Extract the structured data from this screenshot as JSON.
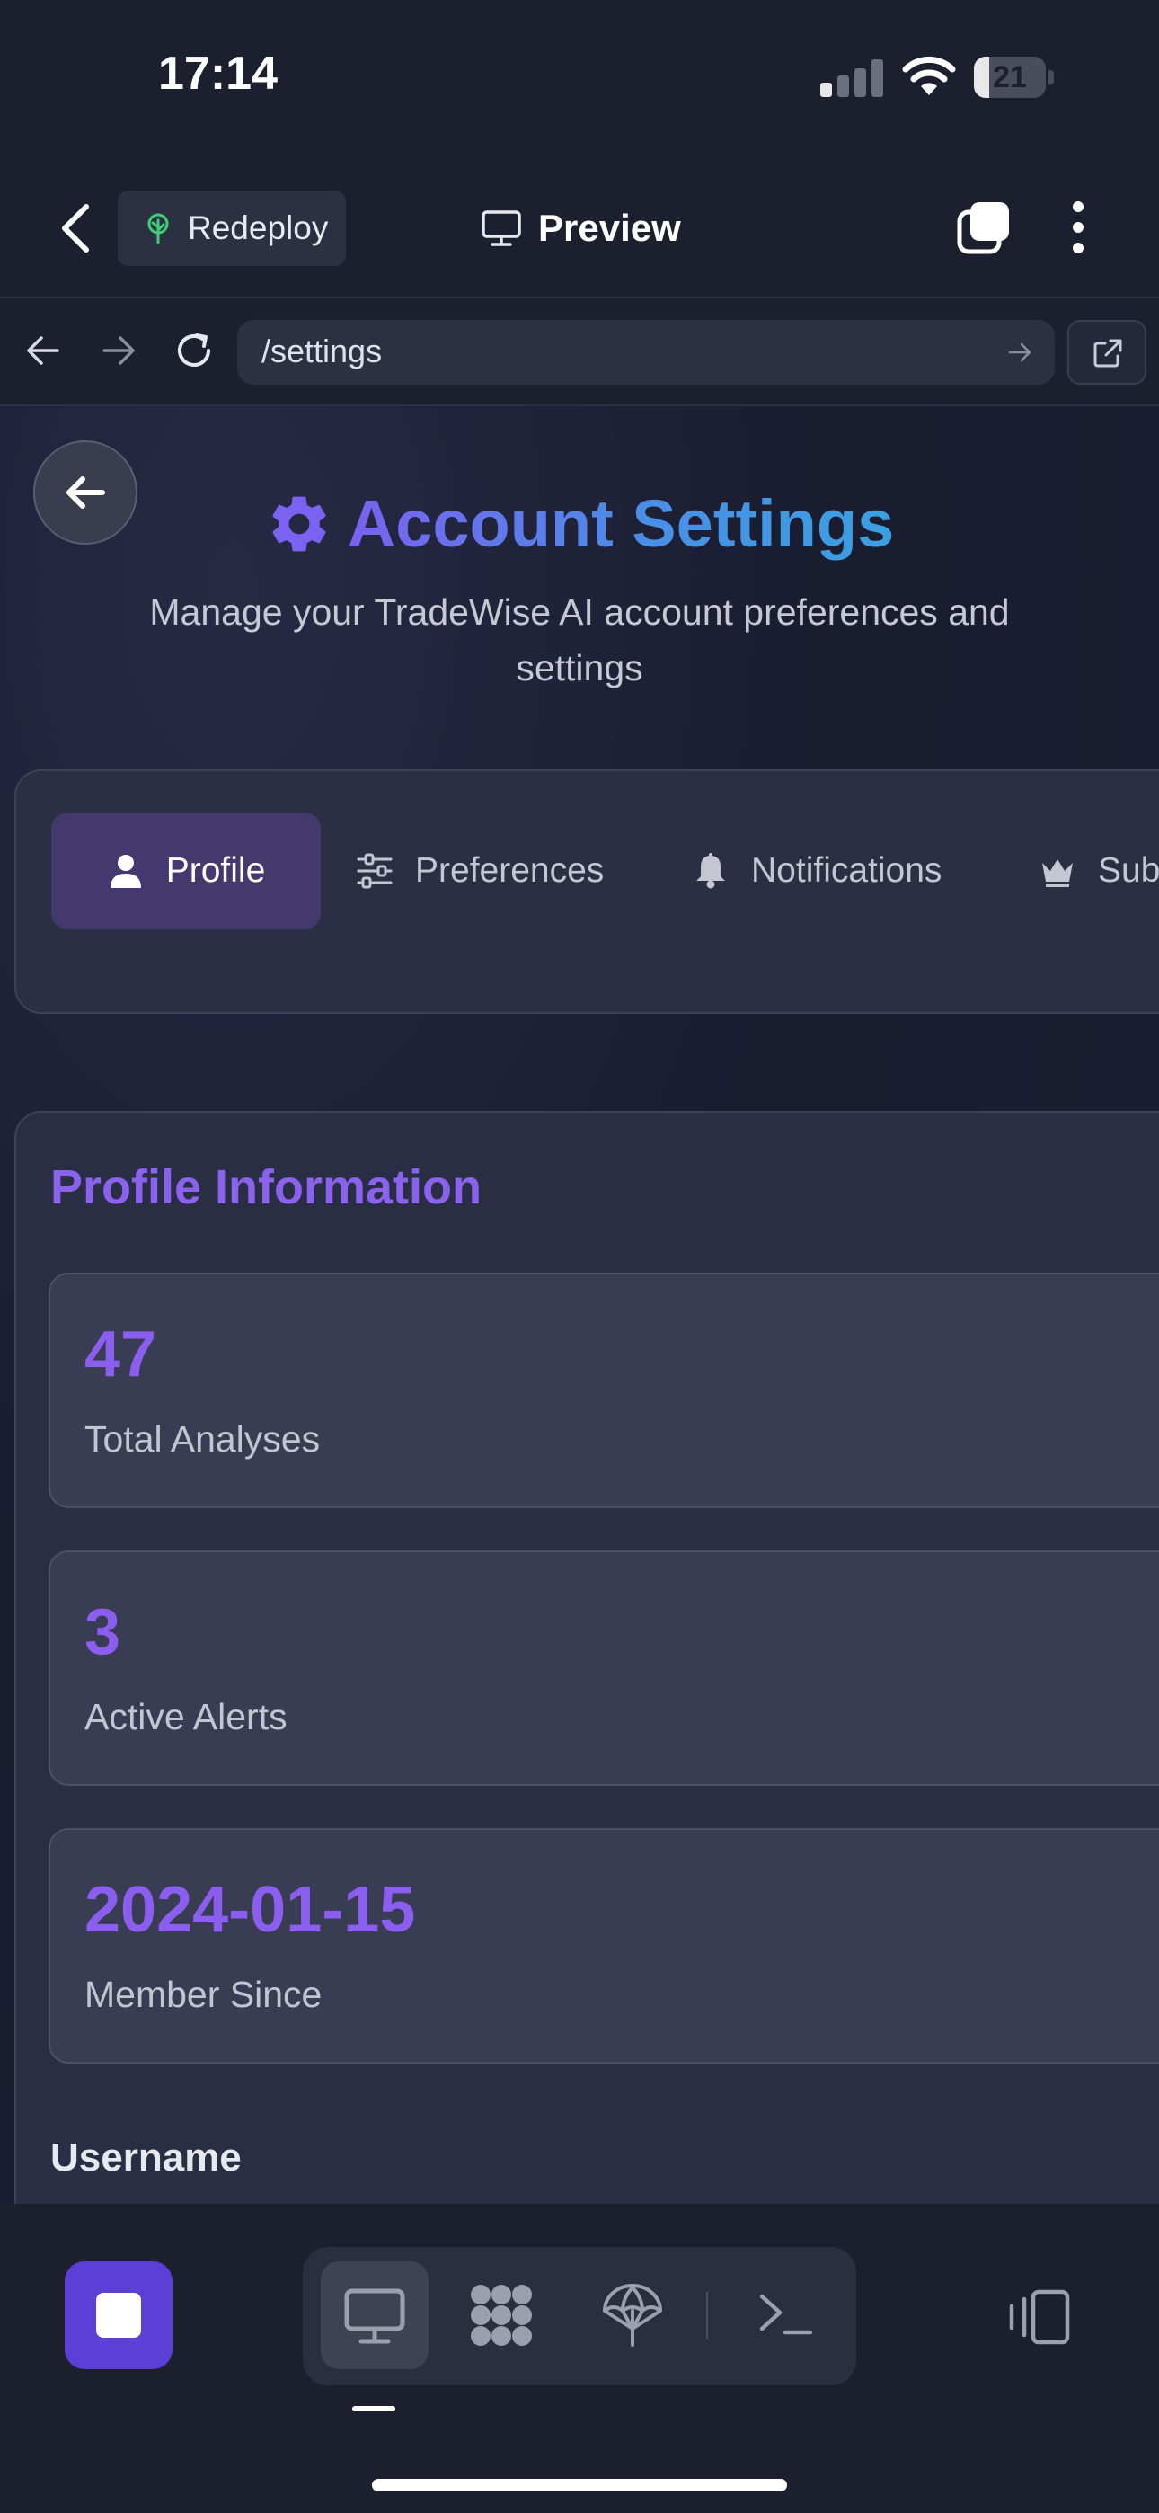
{
  "status_bar": {
    "time": "17:14",
    "battery": "21",
    "battery_level": 0.21
  },
  "header": {
    "redeploy_label": "Redeploy",
    "preview_label": "Preview"
  },
  "browser": {
    "url": "/settings"
  },
  "page": {
    "title": "Account Settings",
    "subtitle": "Manage your TradeWise AI account preferences and settings",
    "tabs": [
      {
        "label": "Profile",
        "icon": "user-icon",
        "active": true
      },
      {
        "label": "Preferences",
        "icon": "sliders-icon",
        "active": false
      },
      {
        "label": "Notifications",
        "icon": "bell-icon",
        "active": false
      },
      {
        "label": "Sub",
        "icon": "crown-icon",
        "active": false
      }
    ],
    "section_title": "Profile Information",
    "stats": [
      {
        "value": "47",
        "label": "Total Analyses"
      },
      {
        "value": "3",
        "label": "Active Alerts"
      },
      {
        "value": "2024-01-15",
        "label": "Member Since"
      }
    ],
    "username_label": "Username"
  },
  "colors": {
    "accent": "#8b5ef0",
    "title_gradient_start": "#7a61f0",
    "title_gradient_end": "#3aa0e0",
    "stop_button": "#5b3fd6",
    "background": "#1c1f2e"
  },
  "toolbar": {
    "icons": [
      "monitor-icon",
      "grid-blob-icon",
      "parachute-icon",
      "terminal-icon"
    ],
    "active": "monitor-icon"
  }
}
